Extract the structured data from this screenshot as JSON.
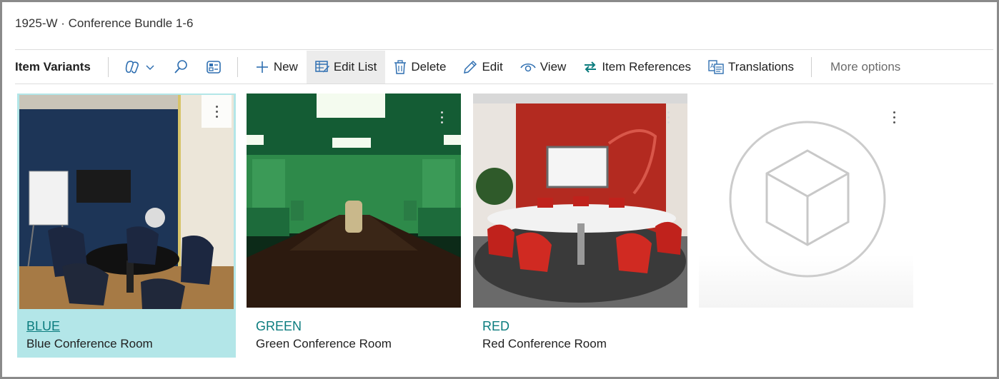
{
  "page": {
    "title": "1925-W · Conference Bundle 1-6"
  },
  "toolbar": {
    "section_title": "Item Variants",
    "new_label": "New",
    "edit_list_label": "Edit List",
    "delete_label": "Delete",
    "edit_label": "Edit",
    "view_label": "View",
    "item_references_label": "Item References",
    "translations_label": "Translations",
    "more_options_label": "More options",
    "icons": [
      "copilot-icon",
      "chevron-down-icon",
      "search-icon",
      "layout-icon"
    ]
  },
  "tiles": [
    {
      "code": "BLUE",
      "description": "Blue Conference Room",
      "selected": true,
      "image": "blue-conference-room-photo"
    },
    {
      "code": "GREEN",
      "description": "Green Conference Room",
      "selected": false,
      "image": "green-conference-room-photo"
    },
    {
      "code": "RED",
      "description": "Red Conference Room",
      "selected": false,
      "image": "red-conference-room-photo"
    },
    {
      "code": "",
      "description": "",
      "selected": false,
      "image": "placeholder-cube-icon"
    }
  ],
  "colors": {
    "accent": "#0b7c7e",
    "selected_tile_bg": "#b3e6e8",
    "active_button_bg": "#ececec"
  }
}
